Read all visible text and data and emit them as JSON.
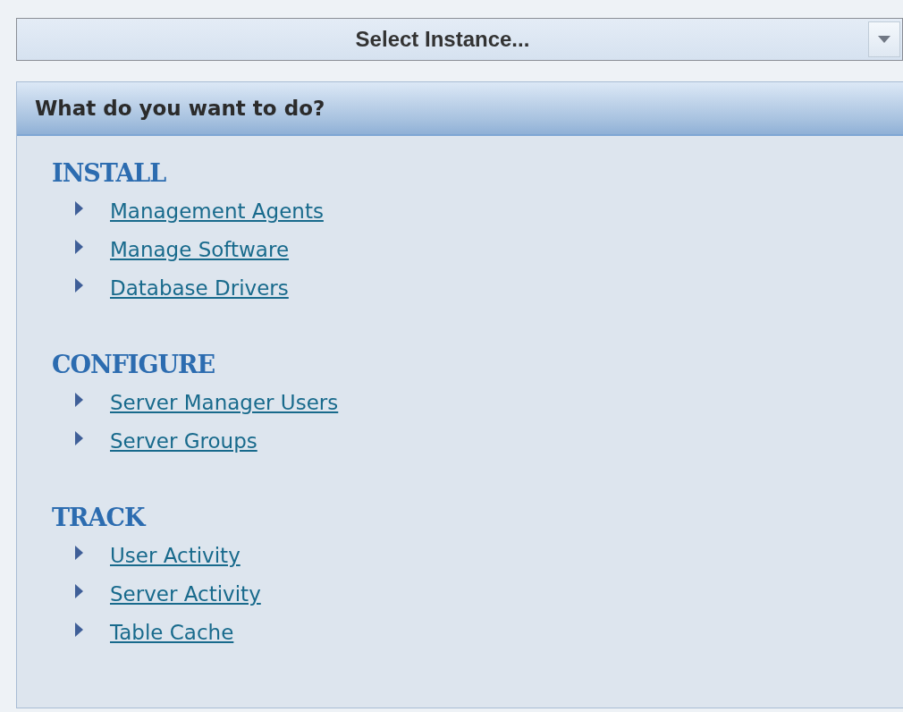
{
  "instance_select": {
    "placeholder": "Select Instance..."
  },
  "panel": {
    "title": "What do you want to do?",
    "sections": [
      {
        "heading": "INSTALL",
        "links": [
          "Management Agents",
          "Manage Software",
          "Database Drivers"
        ]
      },
      {
        "heading": "CONFIGURE",
        "links": [
          "Server Manager Users",
          "Server Groups"
        ]
      },
      {
        "heading": "TRACK",
        "links": [
          "User Activity",
          "Server Activity",
          "Table Cache"
        ]
      }
    ]
  }
}
